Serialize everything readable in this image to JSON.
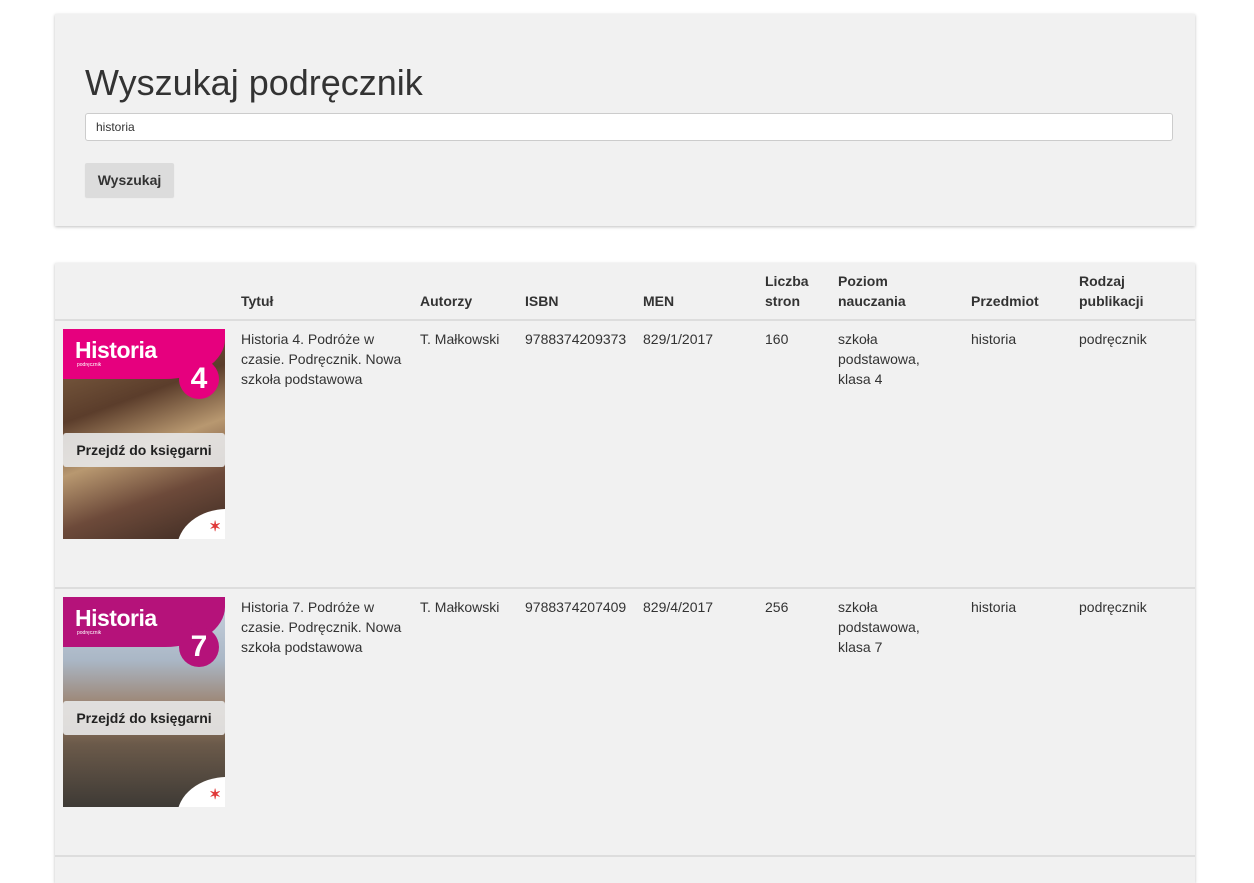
{
  "search": {
    "title": "Wyszukaj podręcznik",
    "input_value": "historia",
    "button_label": "Wyszukaj"
  },
  "table": {
    "headers": {
      "title": "Tytuł",
      "authors": "Autorzy",
      "isbn": "ISBN",
      "men": "MEN",
      "pages_line1": "Liczba",
      "pages_line2": "stron",
      "level_line1": "Poziom",
      "level_line2": "nauczania",
      "subject": "Przedmiot",
      "type_line1": "Rodzaj",
      "type_line2": "publikacji"
    },
    "rows": [
      {
        "cover_title": "Historia",
        "cover_subtitle": "podręcznik",
        "cover_number": "4",
        "cover_color": "#e6007e",
        "shop_button": "Przejdź do księgarni",
        "title": "Historia 4. Podróże w czasie. Podręcznik. Nowa szkoła podstawowa",
        "authors": "T. Małkowski",
        "isbn": "9788374209373",
        "men": "829/1/2017",
        "pages": "160",
        "level": "szkoła podstawowa, klasa 4",
        "subject": "historia",
        "type": "podręcznik"
      },
      {
        "cover_title": "Historia",
        "cover_subtitle": "podręcznik",
        "cover_number": "7",
        "cover_color": "#b5127a",
        "shop_button": "Przejdź do księgarni",
        "title": "Historia 7. Podróże w czasie. Podręcznik. Nowa szkoła podstawowa",
        "authors": "T. Małkowski",
        "isbn": "9788374207409",
        "men": "829/4/2017",
        "pages": "256",
        "level": "szkoła podstawowa, klasa 7",
        "subject": "historia",
        "type": "podręcznik"
      }
    ]
  }
}
